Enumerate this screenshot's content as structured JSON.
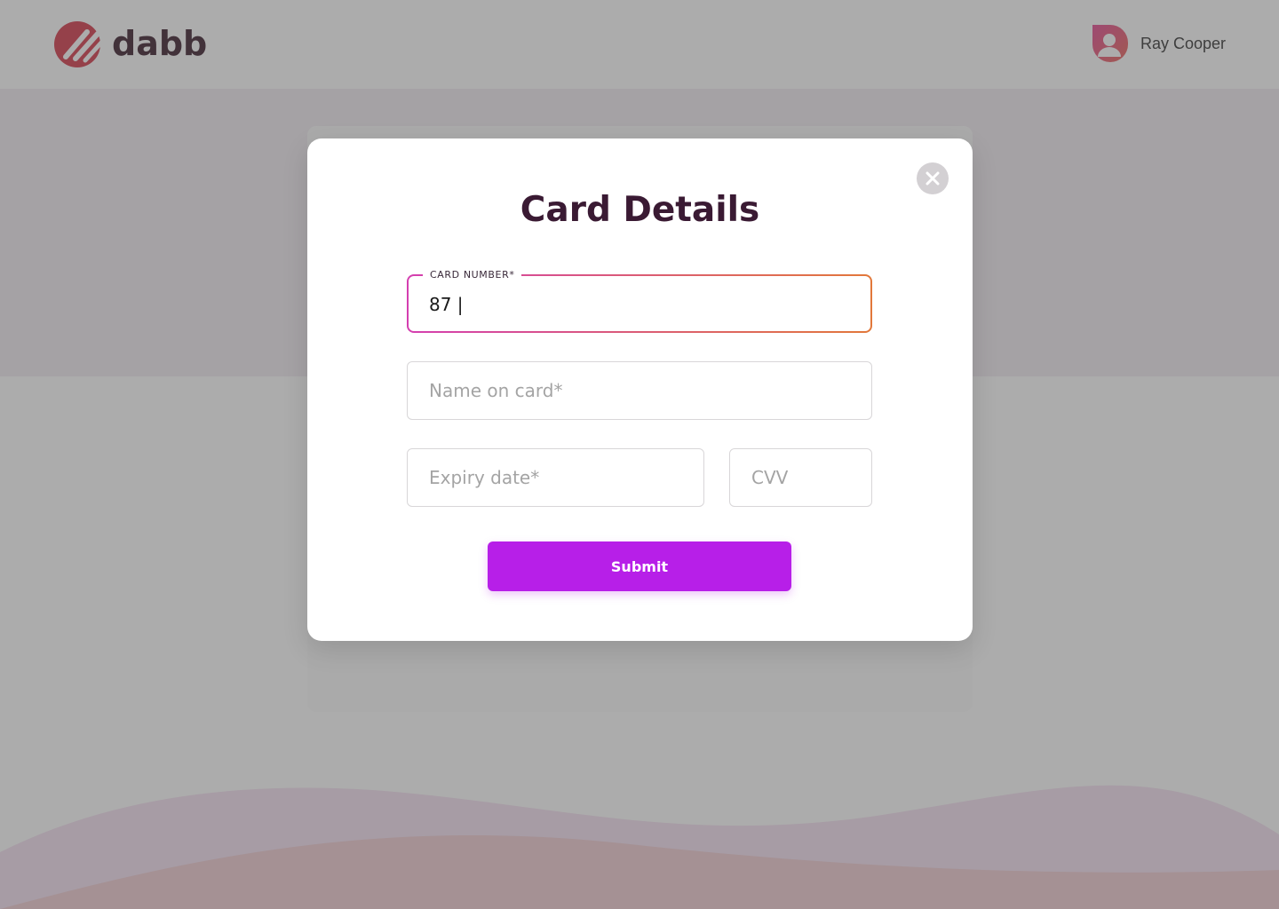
{
  "header": {
    "brand": "dabb",
    "user_name": "Ray Cooper"
  },
  "modal": {
    "title": "Card Details",
    "card_number": {
      "label": "CARD NUMBER*",
      "value": "87 |"
    },
    "name_on_card": {
      "placeholder": "Name on card*"
    },
    "expiry_date": {
      "placeholder": "Expiry date*"
    },
    "cvv": {
      "placeholder": "CVV"
    },
    "submit_label": "Submit"
  },
  "icons": {
    "logo": "dabb-logo-icon",
    "avatar": "user-avatar-icon",
    "close": "close-icon"
  },
  "colors": {
    "accent": "#b71fe8",
    "title": "#3a1a33",
    "brand_red": "#d0283a",
    "field_focus_start": "#d43fb0",
    "field_focus_end": "#e2783a"
  }
}
